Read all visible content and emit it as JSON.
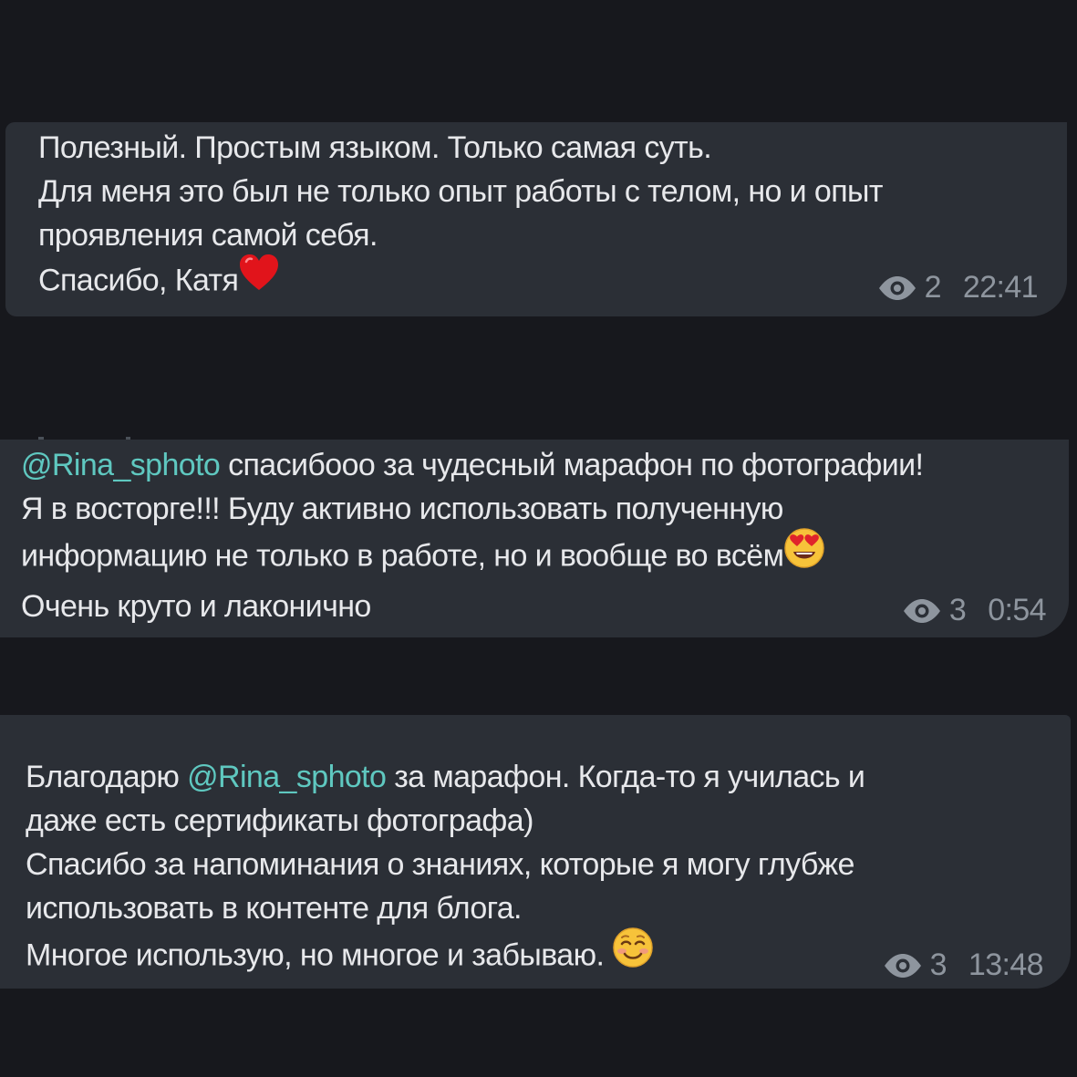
{
  "messages": [
    {
      "lines": [
        "Полезный. Простым языком. Только самая суть.",
        "Для меня это был не только опыт работы с телом, но и опыт",
        "проявления самой себя.",
        "Спасибо, Катя"
      ],
      "views": "2",
      "time": "22:41"
    },
    {
      "mention": "@Rina_sphoto",
      "line1_rest": " спасибооо за чудесный марафон по фотографии!",
      "lines": [
        "Я в восторге!!! Буду активно использовать полученную",
        "информацию не только в работе, но и вообще во всём",
        "Очень круто и лаконично"
      ],
      "views": "3",
      "time": "0:54"
    },
    {
      "line1_start": "Благодарю ",
      "mention": "@Rina_sphoto",
      "line1_rest": " за марафон. Когда-то я училась и",
      "lines": [
        "даже есть сертификаты фотографа)",
        "Спасибо за напоминания о знаниях, которые я могу глубже",
        "использовать в контенте для блога.",
        "Многое использую, но многое и забываю. "
      ],
      "views": "3",
      "time": "13:48"
    }
  ],
  "icons": {
    "views": "eye-icon",
    "emoji_1": "red-heart-emoji",
    "emoji_2": "heart-eyes-emoji",
    "emoji_3": "smiling-face-emoji"
  },
  "colors": {
    "background": "#17181d",
    "bubble": "#2b2f36",
    "text": "#e7e8eb",
    "mention": "#5fc8c0",
    "meta": "#8e959e"
  }
}
